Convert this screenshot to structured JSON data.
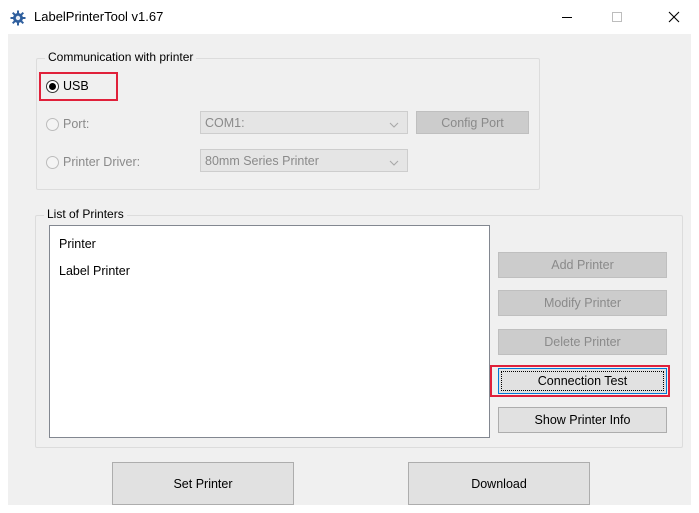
{
  "window": {
    "title": "LabelPrinterTool v1.67",
    "icon": "gear-icon",
    "controls": [
      "minimize-icon",
      "maximize-icon",
      "close-icon"
    ]
  },
  "communication": {
    "legend": "Communication with printer",
    "usb_label": "USB",
    "usb_selected": true,
    "port_label": "Port:",
    "port_value": "COM1:",
    "config_port_label": "Config Port",
    "printer_driver_label": "Printer Driver:",
    "printer_driver_value": "80mm Series Printer"
  },
  "printers": {
    "legend": "List of Printers",
    "items": [
      "Printer",
      "Label Printer"
    ],
    "add_label": "Add Printer",
    "modify_label": "Modify Printer",
    "delete_label": "Delete Printer",
    "connection_test_label": "Connection Test",
    "show_info_label": "Show Printer Info"
  },
  "footer": {
    "set_printer_label": "Set Printer",
    "download_label": "Download"
  },
  "colors": {
    "highlight": "#e0203a",
    "focus": "#0078d7"
  }
}
